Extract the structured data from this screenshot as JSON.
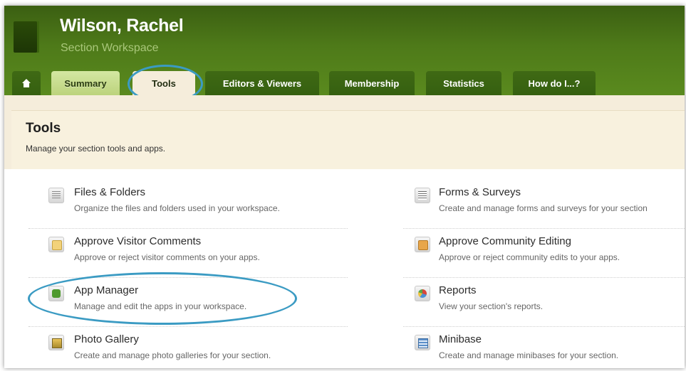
{
  "header": {
    "title": "Wilson, Rachel",
    "subtitle": "Section Workspace"
  },
  "tabs": [
    {
      "label": "Summary"
    },
    {
      "label": "Tools"
    },
    {
      "label": "Editors & Viewers"
    },
    {
      "label": "Membership"
    },
    {
      "label": "Statistics"
    },
    {
      "label": "How do I...?"
    }
  ],
  "page": {
    "title": "Tools",
    "description": "Manage your section tools and apps."
  },
  "tools": [
    {
      "name": "Files & Folders",
      "desc": "Organize the files and folders used in your workspace.",
      "icon": "files-folders-icon"
    },
    {
      "name": "Forms & Surveys",
      "desc": "Create and manage forms and surveys for your section",
      "icon": "forms-surveys-icon"
    },
    {
      "name": "Approve Visitor Comments",
      "desc": "Approve or reject visitor comments on your apps.",
      "icon": "comments-icon"
    },
    {
      "name": "Approve Community Editing",
      "desc": "Approve or reject community edits to your apps.",
      "icon": "community-edit-icon"
    },
    {
      "name": "App Manager",
      "desc": "Manage and edit the apps in your workspace.",
      "icon": "puzzle-icon"
    },
    {
      "name": "Reports",
      "desc": "View your section's reports.",
      "icon": "reports-chart-icon"
    },
    {
      "name": "Photo Gallery",
      "desc": "Create and manage photo galleries for your section.",
      "icon": "photo-gallery-icon"
    },
    {
      "name": "Minibase",
      "desc": "Create and manage minibases for your section.",
      "icon": "minibase-icon"
    }
  ],
  "colors": {
    "header_green": "#4e7a19",
    "tab_light": "#c5dc8b",
    "highlight_blue": "#3b9bc3",
    "panel_beige": "#f5eddb"
  }
}
